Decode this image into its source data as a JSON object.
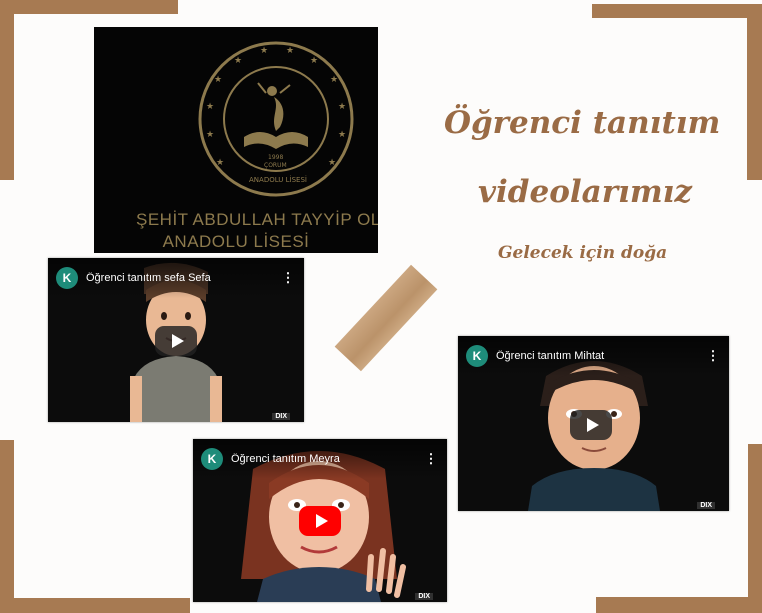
{
  "colors": {
    "frame_brown": "#a77a52",
    "title_brown": "#9a6b45",
    "logo_gold": "#8d7a4d",
    "channel_avatar": "#1e8c7a",
    "play_red": "#ff0000"
  },
  "school": {
    "name_line1": "ŞEHİT ABDULLAH TAYYİP OL",
    "name_line2": "ANADOLU LİSESİ",
    "seal_year": "1998",
    "seal_city": "ÇORUM",
    "seal_bottom": "ANADOLU LİSESİ"
  },
  "heading": {
    "line1": "Öğrenci tanıtım",
    "line2": "videolarımız",
    "subtitle": "Gelecek için doğa"
  },
  "videos": [
    {
      "channel_initial": "K",
      "title": "Öğrenci tanıtım sefa Sefa",
      "menu_icon": "kebab-menu-icon",
      "play_icon": "play-icon",
      "watermark": "DIX"
    },
    {
      "channel_initial": "K",
      "title": "Öğrenci tanıtım Mihtat",
      "menu_icon": "kebab-menu-icon",
      "play_icon": "play-icon",
      "watermark": "DIX"
    },
    {
      "channel_initial": "K",
      "title": "Öğrenci tanıtım Meyra",
      "menu_icon": "kebab-menu-icon",
      "play_icon": "youtube-play-icon",
      "watermark": "DIX"
    }
  ]
}
